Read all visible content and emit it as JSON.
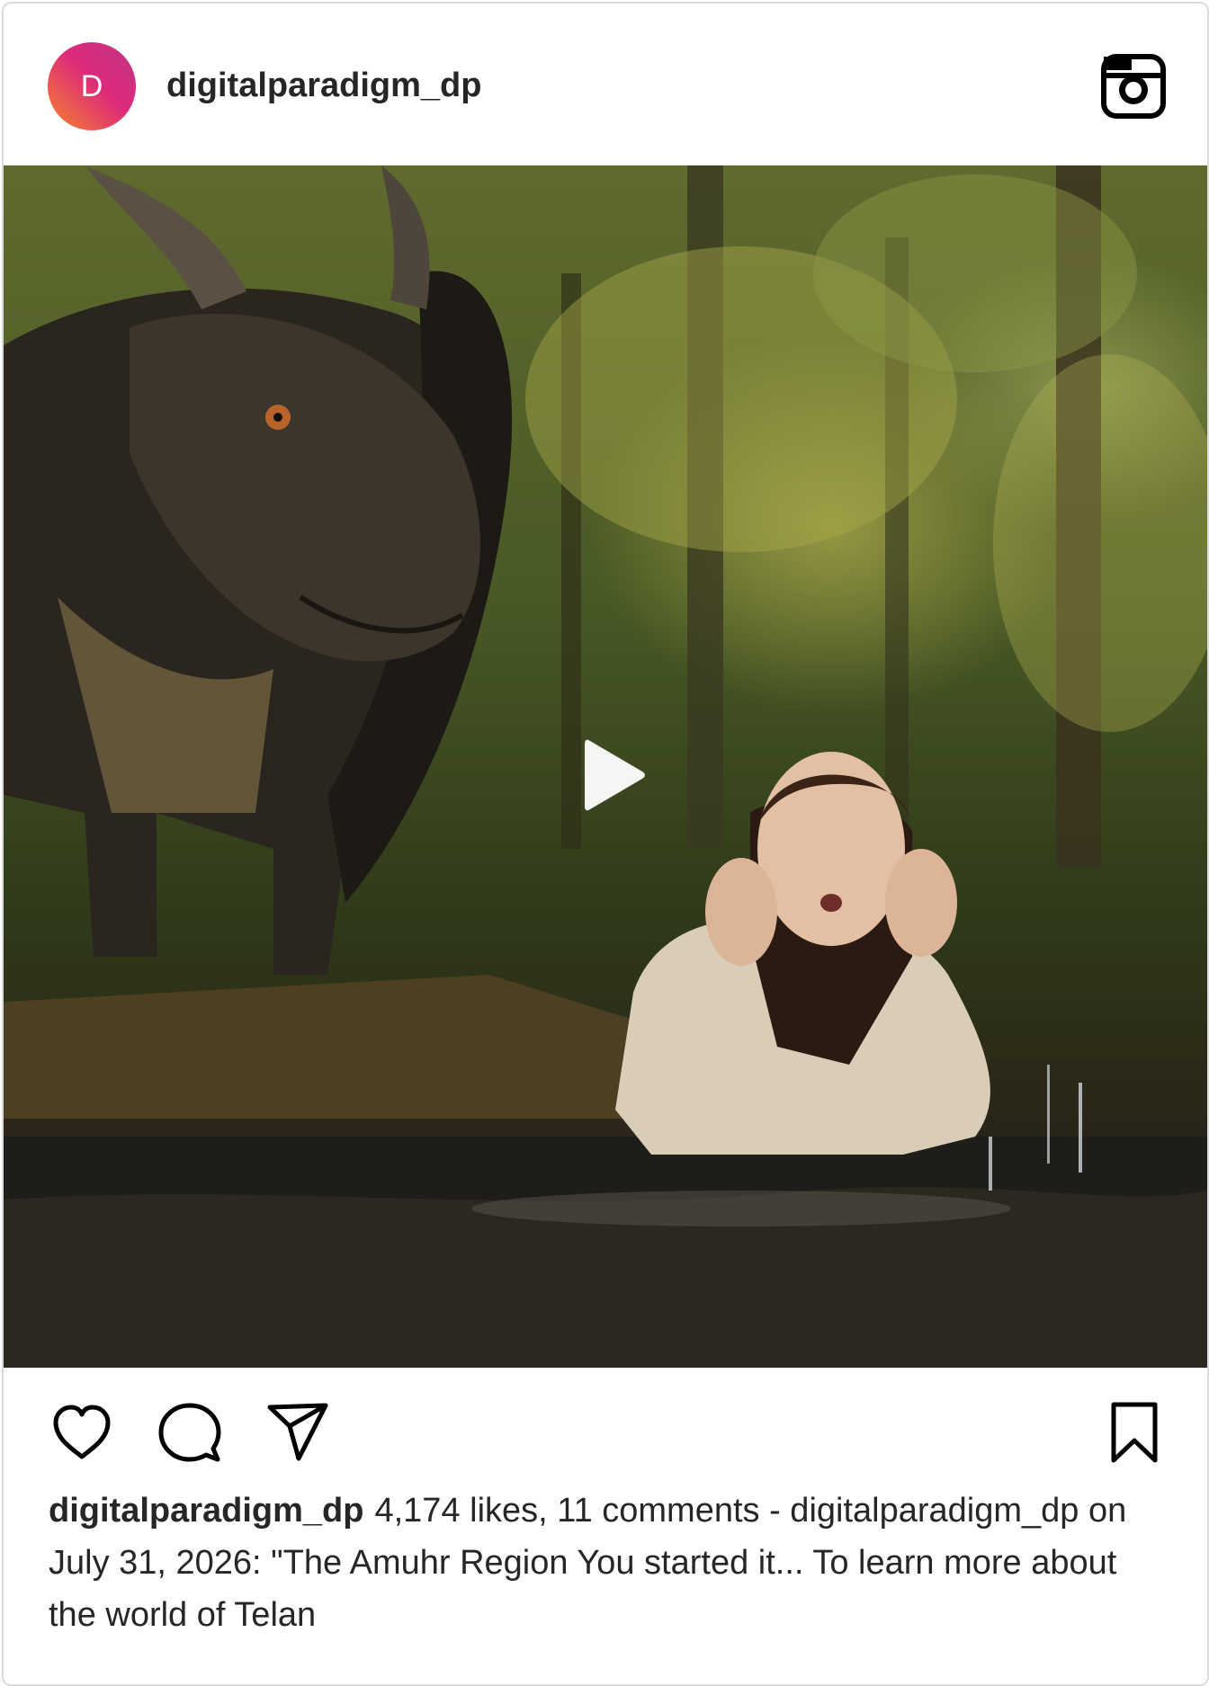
{
  "post": {
    "avatar_initial": "D",
    "username": "digitalparadigm_dp",
    "caption_username": "digitalparadigm_dp",
    "caption_text": "4,174 likes, 11 comments - digitalparadigm_dp on July 31, 2026: \"The Amuhr Region You started it... To learn more about the world of Telan"
  },
  "icons": {
    "header": "instagram-icon",
    "media": "play-icon",
    "actions": [
      "heart-icon",
      "comment-icon",
      "share-icon",
      "bookmark-icon"
    ]
  },
  "colors": {
    "text": "#262626",
    "avatar_gradient_start": "#f58529",
    "avatar_gradient_end": "#c13584",
    "border": "#dbdbdb"
  }
}
